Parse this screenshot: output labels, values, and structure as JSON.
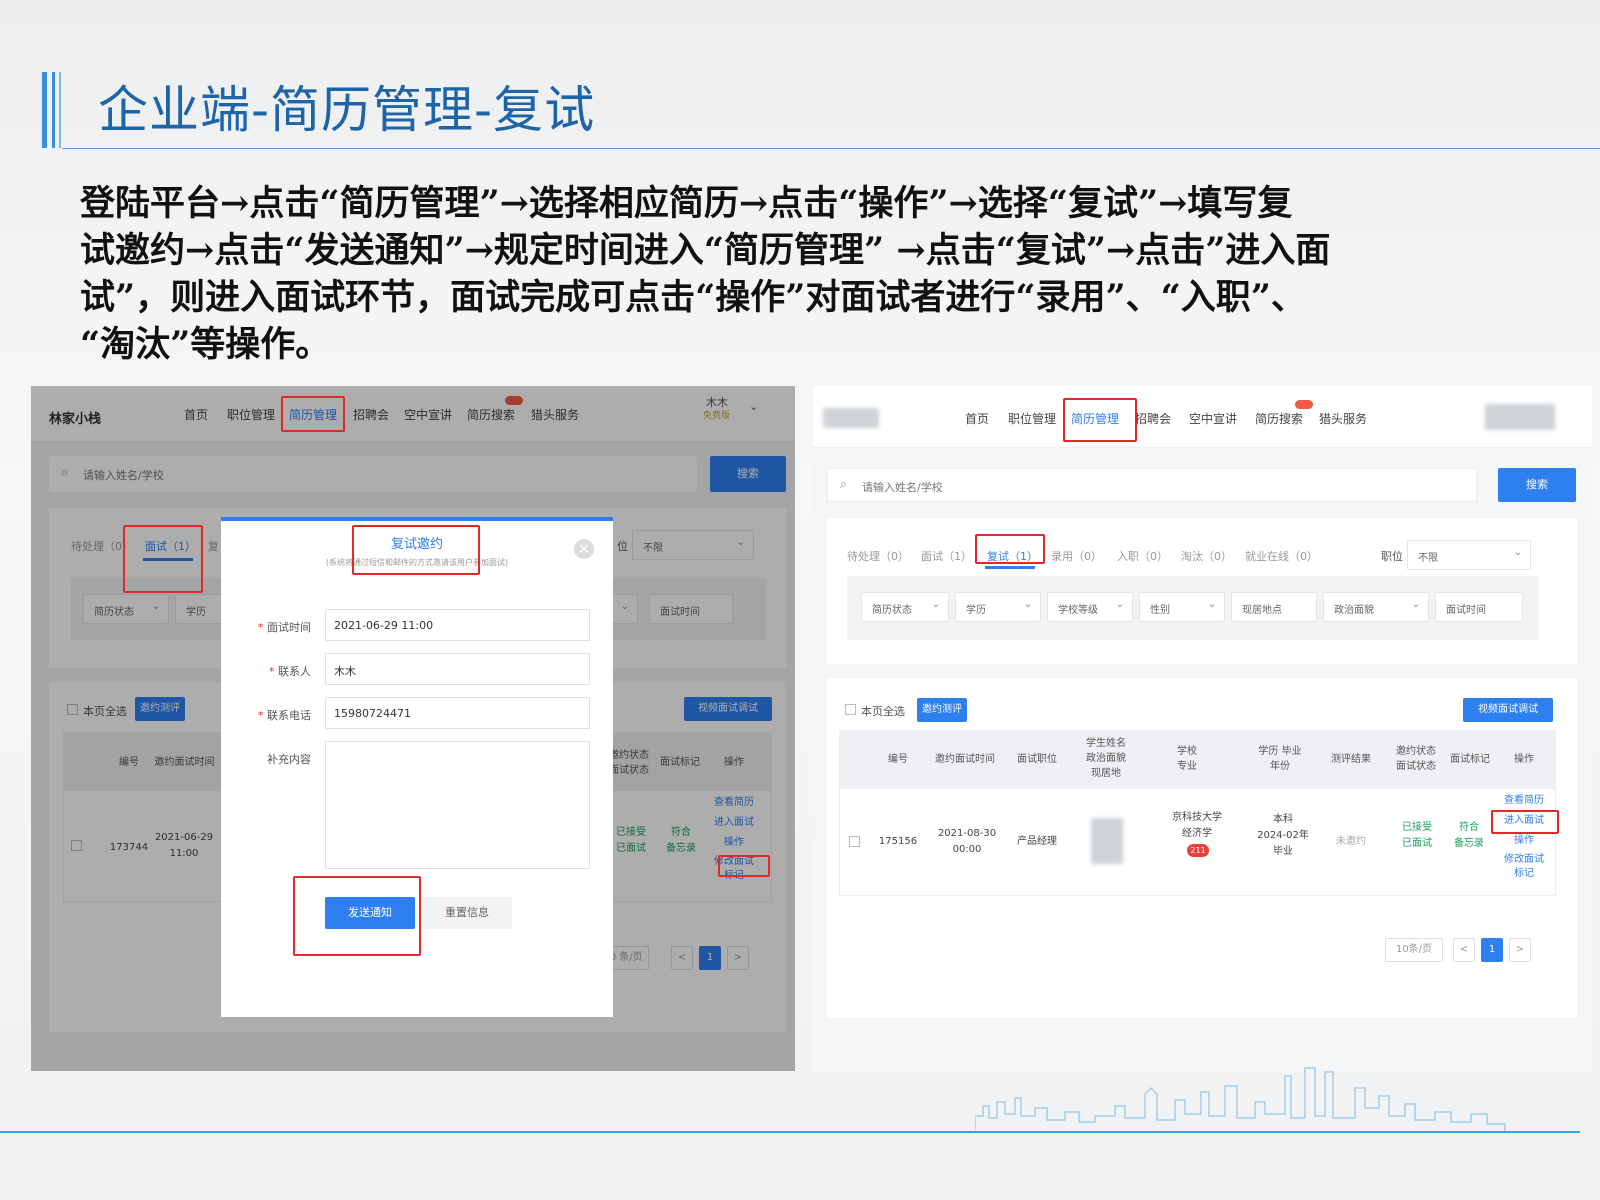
{
  "slide": {
    "title": "企业端-简历管理-复试",
    "instructions": [
      "登陆平台→点击“简历管理”→选择相应简历→点击“操作”→选择“复试”→填写复",
      "试邀约→点击“发送通知”→规定时间进入“简历管理” →点击“复试”→点击”进入面",
      "试”，则进入面试环节，面试完成可点击“操作”对面试者进行“录用”、“入职”、",
      "“淘汰”等操作。"
    ]
  },
  "colors": {
    "accent": "#2e7ff0",
    "highlight": "#e02a2a",
    "title": "#1d64a8",
    "success": "#1aa35b"
  },
  "left": {
    "brand": "林家小栈",
    "nav": [
      "首页",
      "职位管理",
      "简历管理",
      "招聘会",
      "空中宣讲",
      "简历搜索",
      "猎头服务"
    ],
    "user": {
      "name": "木木",
      "sub": "免费版"
    },
    "search": {
      "placeholder": "请输入姓名/学校",
      "button": "搜索"
    },
    "tabs": [
      "待处理（0）",
      "面试（1）",
      "复"
    ],
    "position_filter": {
      "label": "位",
      "value": "不限"
    },
    "filters": [
      "简历状态",
      "学历",
      "面试时间"
    ],
    "select_all": "本页全选",
    "invite_btn": "邀约测评",
    "video_btn": "视频面试调试",
    "headers": [
      "编号",
      "邀约面试时间",
      "邀约状态 面试状态",
      "面试标记",
      "操作"
    ],
    "row": {
      "id": "173744",
      "time": "2021-06-29 11:00",
      "status1": "已接受",
      "status2": "已面试",
      "mark1": "符合",
      "mark2": "备忘录",
      "actions": [
        "查看简历",
        "进入面试",
        "操作",
        "修改面试标记"
      ]
    },
    "pager": {
      "size": "10 条/页",
      "page": "1",
      "prev": "<",
      "next": ">"
    }
  },
  "modal": {
    "title": "复试邀约",
    "subtitle": "(系统将通过短信和邮件的方式邀请该用户参加面试)",
    "close": "×",
    "fields": [
      {
        "label": "面试时间",
        "required": true,
        "value": "2021-06-29 11:00"
      },
      {
        "label": "联系人",
        "required": true,
        "value": "木木"
      },
      {
        "label": "联系电话",
        "required": true,
        "value": "15980724471"
      }
    ],
    "extra_label": "补充内容",
    "extra_value": "",
    "send": "发送通知",
    "reset": "重置信息"
  },
  "right": {
    "nav": [
      "首页",
      "职位管理",
      "简历管理",
      "招聘会",
      "空中宣讲",
      "简历搜索",
      "猎头服务"
    ],
    "search": {
      "placeholder": "请输入姓名/学校",
      "button": "搜索"
    },
    "tabs": [
      "待处理（0）",
      "面试（1）",
      "复试（1）",
      "录用（0）",
      "入职（0）",
      "淘汰（0）",
      "就业在线（0）"
    ],
    "position_filter": {
      "label": "职位",
      "value": "不限"
    },
    "filters": [
      "简历状态",
      "学历",
      "学校等级",
      "性别",
      "现居地点",
      "政治面貌",
      "面试时间"
    ],
    "select_all": "本页全选",
    "invite_btn": "邀约测评",
    "video_btn": "视频面试调试",
    "headers": [
      "编号",
      "邀约面试时间",
      "面试职位",
      "学生姓名 政治面貌 现居地",
      "学校 专业",
      "学历 毕业年份",
      "测评结果",
      "邀约状态 面试状态",
      "面试标记",
      "操作"
    ],
    "row": {
      "id": "175156",
      "time": "2021-08-30 00:00",
      "position": "产品经理",
      "school": "京科技大学",
      "major": "经济学",
      "tag": "211",
      "degree": "本科",
      "grad": "2024-02年",
      "grad2": "毕业",
      "eval": "未邀约",
      "status1": "已接受",
      "status2": "已面试",
      "mark1": "符合",
      "mark2": "备忘录",
      "actions": [
        "查看简历",
        "进入面试",
        "操作",
        "修改面试标记"
      ]
    },
    "pager": {
      "size": "10条/页",
      "page": "1",
      "prev": "<",
      "next": ">"
    }
  }
}
